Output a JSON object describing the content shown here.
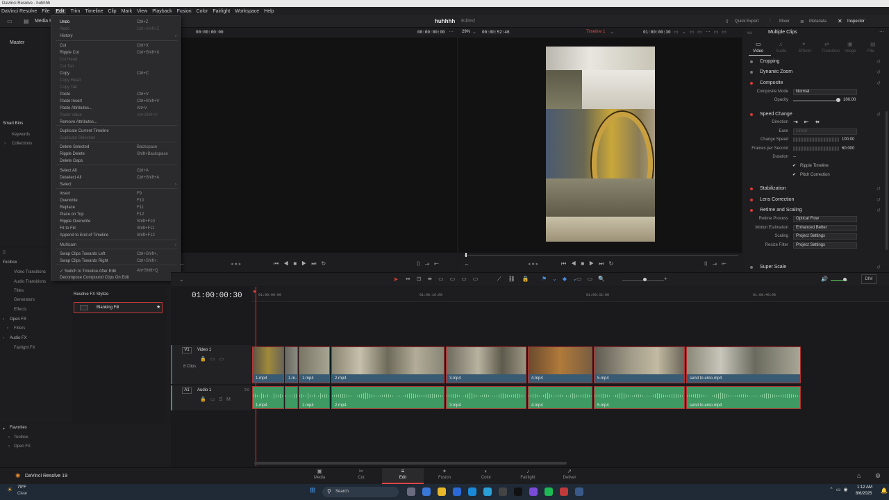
{
  "window_title": "DaVinci Resolve - huhhhh",
  "menu": [
    "DaVinci Resolve",
    "File",
    "Edit",
    "Trim",
    "Timeline",
    "Clip",
    "Mark",
    "View",
    "Playback",
    "Fusion",
    "Color",
    "Fairlight",
    "Workspace",
    "Help"
  ],
  "toolbar": {
    "media_pool": "Media P",
    "project_title": "huhhhh",
    "edited": "Edited",
    "quick_export": "Quick Export",
    "mixer": "Mixer",
    "metadata": "Metadata",
    "inspector": "Inspector"
  },
  "left_panel": {
    "master": "Master",
    "smart_bins": "Smart Bins",
    "keywords": "Keywords",
    "collections": "Collections"
  },
  "effects_panel": {
    "tree": [
      "Toolbox",
      "Video Transitions",
      "Audio Transitions",
      "Titles",
      "Generators",
      "Effects",
      "Open FX",
      "Filters",
      "Audio FX",
      "Fairlight FX"
    ],
    "group_title": "Resolve FX Stylize",
    "selected_effect": "Blanking Fill",
    "favorites": "Favorites",
    "fav_items": [
      "Toolbox",
      "Open FX"
    ]
  },
  "edit_menu": {
    "items": [
      {
        "label": "Undo",
        "shortcut": "Ctrl+Z",
        "state": "hl"
      },
      {
        "label": "Redo",
        "shortcut": "Ctrl+Shift+Z",
        "state": "dis"
      },
      {
        "label": "History",
        "shortcut": "",
        "state": "n"
      },
      {
        "label": "Cut",
        "shortcut": "Ctrl+X",
        "state": "n"
      },
      {
        "label": "Ripple Cut",
        "shortcut": "Ctrl+Shift+X",
        "state": "n"
      },
      {
        "label": "Cut Head",
        "shortcut": "",
        "state": "dis"
      },
      {
        "label": "Cut Tail",
        "shortcut": "",
        "state": "dis"
      },
      {
        "label": "Copy",
        "shortcut": "Ctrl+C",
        "state": "n"
      },
      {
        "label": "Copy Head",
        "shortcut": "",
        "state": "dis"
      },
      {
        "label": "Copy Tail",
        "shortcut": "",
        "state": "dis"
      },
      {
        "label": "Paste",
        "shortcut": "Ctrl+V",
        "state": "n"
      },
      {
        "label": "Paste Insert",
        "shortcut": "Ctrl+Shift+V",
        "state": "n"
      },
      {
        "label": "Paste Attributes...",
        "shortcut": "Alt+V",
        "state": "n"
      },
      {
        "label": "Paste Value",
        "shortcut": "Alt+Shift+V",
        "state": "dis"
      },
      {
        "label": "Remove Attributes...",
        "shortcut": "",
        "state": "n"
      },
      {
        "label": "Duplicate Current Timeline",
        "shortcut": "",
        "state": "n"
      },
      {
        "label": "Duplicate Selection",
        "shortcut": "",
        "state": "dis"
      },
      {
        "label": "Delete Selected",
        "shortcut": "Backspace",
        "state": "n"
      },
      {
        "label": "Ripple Delete",
        "shortcut": "Shift+Backspace",
        "state": "n"
      },
      {
        "label": "Delete Gaps",
        "shortcut": "",
        "state": "n"
      },
      {
        "label": "Select All",
        "shortcut": "Ctrl+A",
        "state": "n"
      },
      {
        "label": "Deselect All",
        "shortcut": "Ctrl+Shift+A",
        "state": "n"
      },
      {
        "label": "Select",
        "shortcut": "",
        "state": "n"
      },
      {
        "label": "Insert",
        "shortcut": "F9",
        "state": "n"
      },
      {
        "label": "Overwrite",
        "shortcut": "F10",
        "state": "n"
      },
      {
        "label": "Replace",
        "shortcut": "F11",
        "state": "n"
      },
      {
        "label": "Place on Top",
        "shortcut": "F12",
        "state": "n"
      },
      {
        "label": "Ripple Overwrite",
        "shortcut": "Shift+F10",
        "state": "n"
      },
      {
        "label": "Fit to Fill",
        "shortcut": "Shift+F11",
        "state": "n"
      },
      {
        "label": "Append to End of Timeline",
        "shortcut": "Shift+F12",
        "state": "n"
      },
      {
        "label": "Multicam",
        "shortcut": "",
        "state": "n"
      },
      {
        "label": "Swap Clips Towards Left",
        "shortcut": "Ctrl+Shift+,",
        "state": "n"
      },
      {
        "label": "Swap Clips Towards Right",
        "shortcut": "Ctrl+Shift+.",
        "state": "n"
      },
      {
        "label": "✓ Switch to Timeline After Edit",
        "shortcut": "Alt+Shift+Q",
        "state": "n"
      },
      {
        "label": "Decompose Compound Clips On Edit",
        "shortcut": "",
        "state": "n"
      }
    ]
  },
  "source_viewer": {
    "timecode_left": "00:00:00:00",
    "timecode_right": "00:00:00:00"
  },
  "program_viewer": {
    "zoom": "29%",
    "duration": "00:00:52:46",
    "timeline_name": "Timeline 1",
    "timecode": "01:00:00:30"
  },
  "inspector": {
    "title": "Multiple Clips",
    "tabs": [
      "Video",
      "Audio",
      "Effects",
      "Transition",
      "Image",
      "File"
    ],
    "sections": [
      "Cropping",
      "Dynamic Zoom",
      "Composite",
      "Speed Change",
      "Stabilization",
      "Lens Correction",
      "Retime and Scaling",
      "Super Scale"
    ],
    "composite_mode_label": "Composite Mode",
    "composite_mode": "Normal",
    "opacity_label": "Opacity",
    "opacity": "100.00",
    "direction_label": "Direction",
    "ease_label": "Ease",
    "ease_value": "Linear",
    "change_speed_label": "Change Speed",
    "change_speed": "100.00",
    "fps_label": "Frames per Second",
    "fps": "60.000",
    "duration_label": "Duration",
    "duration": "--",
    "ripple_timeline": "Ripple Timeline",
    "pitch_correction": "Pitch Correction",
    "retime_process_label": "Retime Process",
    "retime_process": "Optical Flow",
    "motion_est_label": "Motion Estimation",
    "motion_est": "Enhanced Better",
    "scaling_label": "Scaling",
    "scaling": "Project Settings",
    "resize_filter_label": "Resize Filter",
    "resize_filter": "Project Settings"
  },
  "timeline": {
    "timecode": "01:00:00:30",
    "ruler": [
      "01:00:00:00",
      "01:00:16:00",
      "01:00:32:00",
      "01:00:48:00"
    ],
    "v1_tag": "V1",
    "v1_name": "Video 1",
    "v1_count": "8 Clips",
    "a1_tag": "A1",
    "a1_name": "Audio 1",
    "a1_level": "2.0",
    "dim": "DIM",
    "video_clips": [
      "1.mp4",
      "1.m...",
      "1.mp4",
      "2.mp4",
      "3.mp4",
      "4.mp4",
      "5.mp4",
      "send to emo.mp4"
    ],
    "audio_clips": [
      "1.mp4",
      "1.mp4",
      "2.mp4",
      "3.mp4",
      "4.mp4",
      "5.mp4",
      "send to emo.mp4"
    ]
  },
  "pages": [
    {
      "label": "Media",
      "icon": "▣"
    },
    {
      "label": "Cut",
      "icon": "✂"
    },
    {
      "label": "Edit",
      "icon": "≡"
    },
    {
      "label": "Fusion",
      "icon": "✦"
    },
    {
      "label": "Color",
      "icon": "◐"
    },
    {
      "label": "Fairlight",
      "icon": "♪"
    },
    {
      "label": "Deliver",
      "icon": "➚"
    }
  ],
  "app_brand": "DaVinci Resolve 19",
  "taskbar": {
    "weather_temp": "79°F",
    "weather_desc": "Clear",
    "search": "Search",
    "time": "1:12 AM",
    "date": "8/6/2025"
  }
}
